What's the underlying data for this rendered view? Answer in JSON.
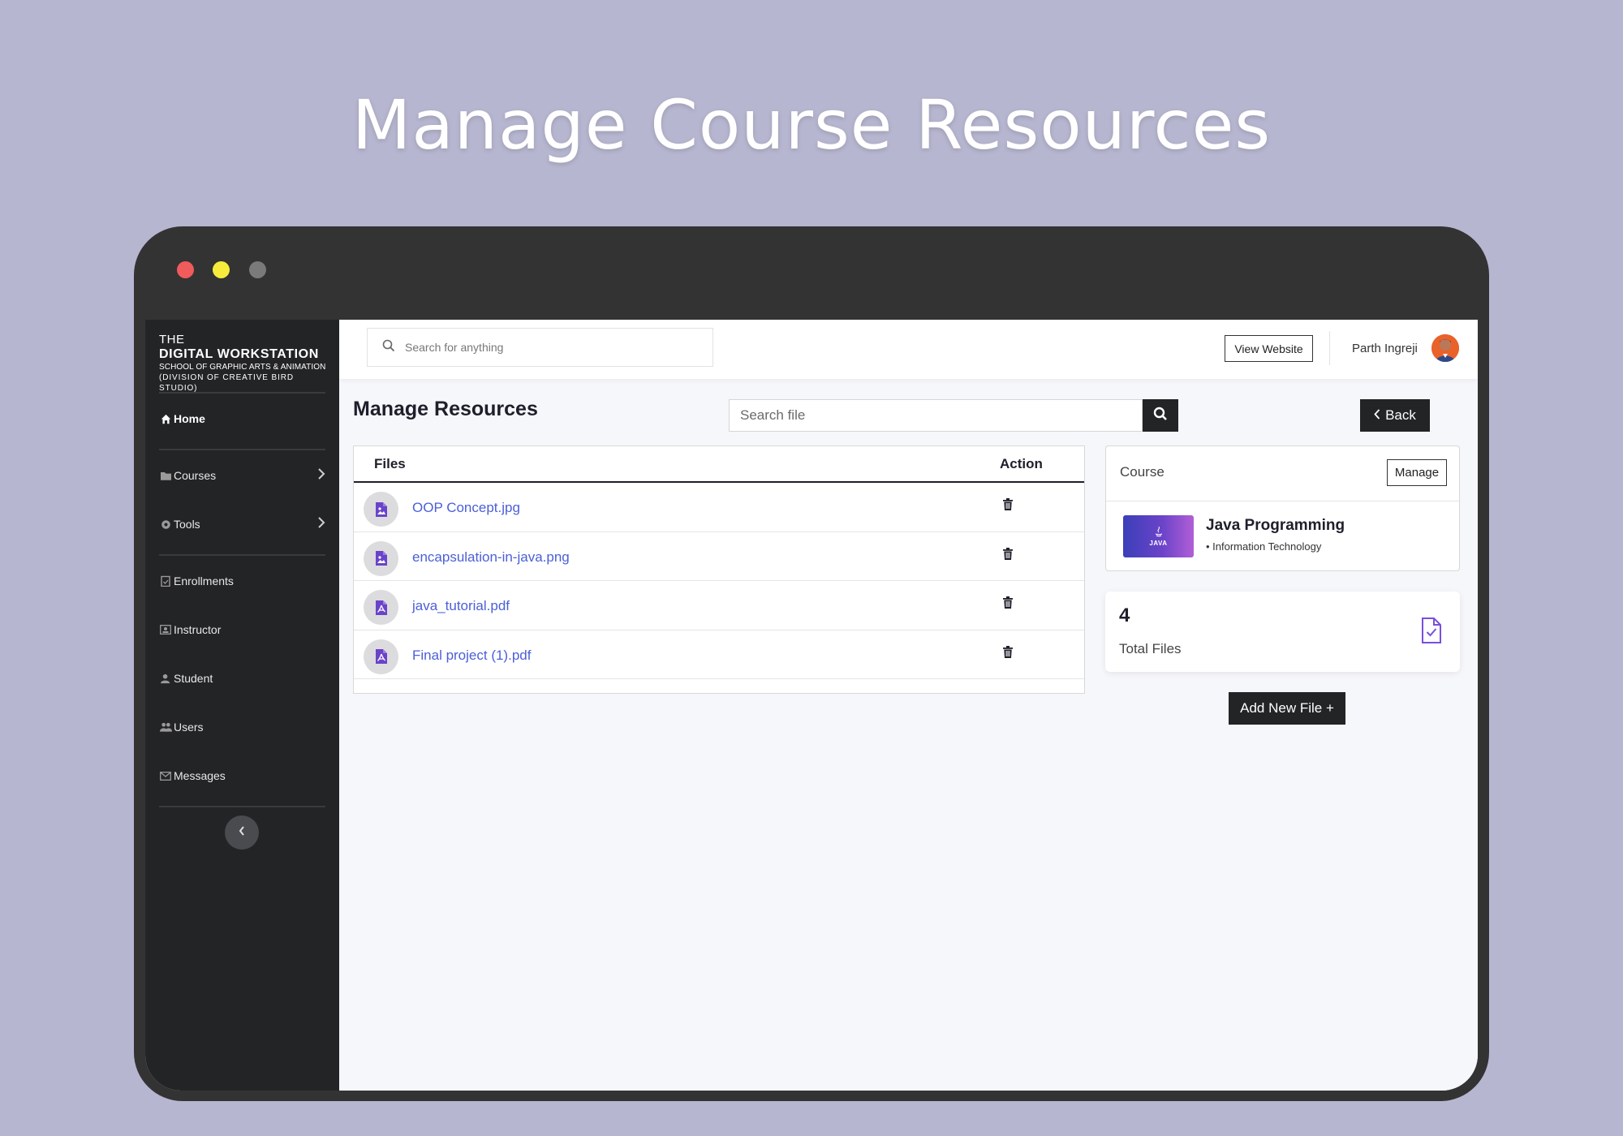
{
  "hero": {
    "title": "Manage Course Resources"
  },
  "brand": {
    "line1": "THE",
    "line2": "DIGITAL WORKSTATION",
    "line3": "SCHOOL OF GRAPHIC ARTS & ANIMATION",
    "line4": "(DIVISION OF CREATIVE BIRD STUDIO)"
  },
  "sidebar": {
    "items": [
      {
        "label": "Home",
        "icon": "home-icon",
        "active": true
      },
      {
        "label": "Courses",
        "icon": "folder-icon"
      },
      {
        "label": "Tools",
        "icon": "gear-icon"
      },
      {
        "label": "Enrollments",
        "icon": "clipboard-icon"
      },
      {
        "label": "Instructor",
        "icon": "id-card-icon"
      },
      {
        "label": "Student",
        "icon": "user-icon"
      },
      {
        "label": "Users",
        "icon": "users-icon"
      },
      {
        "label": "Messages",
        "icon": "mail-icon"
      }
    ]
  },
  "topbar": {
    "search_placeholder": "Search for anything",
    "view_website": "View Website",
    "user_name": "Parth Ingreji"
  },
  "main": {
    "title": "Manage Resources",
    "search_placeholder": "Search file",
    "back_label": "Back"
  },
  "files": {
    "header_files": "Files",
    "header_action": "Action",
    "rows": [
      {
        "name": "OOP Concept.jpg",
        "type": "image"
      },
      {
        "name": "encapsulation-in-java.png",
        "type": "image"
      },
      {
        "name": "java_tutorial.pdf",
        "type": "pdf"
      },
      {
        "name": "Final project (1).pdf",
        "type": "pdf"
      }
    ]
  },
  "course": {
    "label": "Course",
    "manage_label": "Manage",
    "name": "Java Programming",
    "category": "• Information Technology",
    "thumb_text": "JAVA"
  },
  "stats": {
    "count": "4",
    "label": "Total Files"
  },
  "add_button": "Add New File +",
  "colors": {
    "background": "#b7b6d0",
    "device": "#333334",
    "sidebar": "#232426",
    "link": "#4b5fd6",
    "accent_purple": "#6a43c9"
  }
}
